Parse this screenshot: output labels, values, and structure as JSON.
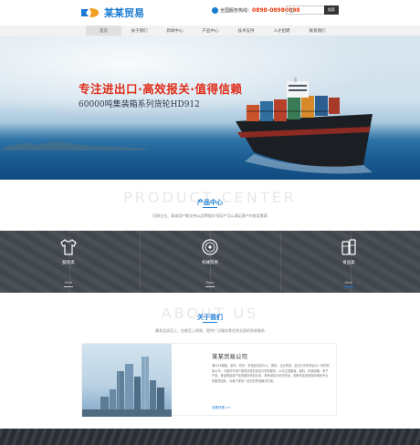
{
  "header": {
    "logo_text": "某某贸易",
    "hotline_label": "全国服务热线：",
    "hotline_number": "0898-08980898",
    "search_placeholder": "",
    "search_button": "搜索"
  },
  "nav": {
    "items": [
      {
        "label": "首页"
      },
      {
        "label": "关于我们"
      },
      {
        "label": "新闻中心"
      },
      {
        "label": "产品中心"
      },
      {
        "label": "技术支持"
      },
      {
        "label": "人才招聘"
      },
      {
        "label": "联系我们"
      }
    ]
  },
  "banner": {
    "slogan": "专注进出口·高效报关·值得信赖",
    "subslogan": "60000吨集装箱系列货轮HD912"
  },
  "products": {
    "watermark": "PRODUCT CENTER",
    "title": "产品中心",
    "description": "回馈企业、真诚用户都支持以品牌服务!保证产品以满足客户的各类需要",
    "items": [
      {
        "label": "服装类",
        "more": "More",
        "icon": "shirt-icon"
      },
      {
        "label": "机械贸易",
        "more": "More",
        "icon": "disc-icon"
      },
      {
        "label": "食品类",
        "more": "More",
        "icon": "food-icon"
      }
    ]
  },
  "about": {
    "watermark": "ABOUT US",
    "title": "关于我们",
    "description": "秉承品质至上、信誉至上原则、提供广泛服务等优质全面的贸易服务",
    "company": "某某贸易公司",
    "paragraph": "海口XX服装、染料、纺织、家电及玩具中心，国际、企业贸易、进出口中转货运为一体的贸易公司，为国内外用户提供优质的进出口贸易服务。公司主营服装、面料、机械设备、电子产品、食品等各类产品的国际贸易业务，秉承诚信为本的宗旨，拥有完善的销售网络和专业的服务团队，为客户提供一站式的贸易解决方案。",
    "more": "查看详情 >>"
  },
  "colors": {
    "accent": "#1a7bd0",
    "slogan_red": "#e02b17",
    "hotline_red": "#e8390e",
    "band_dark": "#454a52"
  }
}
